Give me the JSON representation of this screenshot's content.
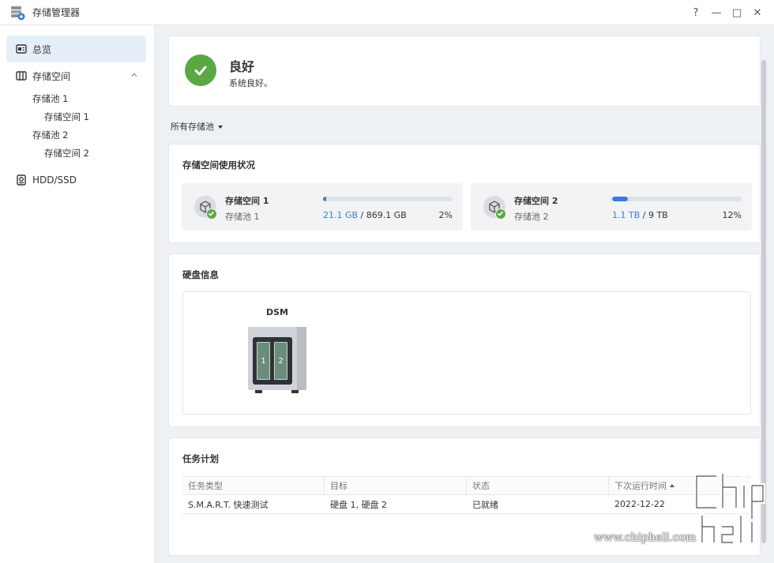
{
  "window": {
    "title": "存储管理器",
    "controls": [
      "?",
      "—",
      "□",
      "✕"
    ]
  },
  "sidebar": {
    "overview": "总览",
    "storage": "存储空间",
    "pool1": "存储池 1",
    "volume1": "存储空间 1",
    "pool2": "存储池 2",
    "volume2": "存储空间 2",
    "hdd": "HDD/SSD"
  },
  "status": {
    "title": "良好",
    "subtitle": "系统良好。",
    "color": "#5ba745"
  },
  "filter": {
    "label": "所有存储池"
  },
  "usage": {
    "title": "存储空间使用状况",
    "volumes": [
      {
        "name": "存储空间 1",
        "pool": "存储池 1",
        "used": "21.1 GB",
        "sep": " / ",
        "total": "869.1 GB",
        "percent": "2%",
        "fill": 0.024
      },
      {
        "name": "存储空间 2",
        "pool": "存储池 2",
        "used": "1.1 TB",
        "sep": " / ",
        "total": "9 TB",
        "percent": "12%",
        "fill": 0.12
      }
    ],
    "bar_color": "#3e7bd6"
  },
  "disk": {
    "title": "硬盘信息",
    "device": "DSM",
    "bays": [
      "1",
      "2"
    ]
  },
  "tasks": {
    "title": "任务计划",
    "columns": [
      "任务类型",
      "目标",
      "状态",
      "下次运行时间"
    ],
    "rows": [
      [
        "S.M.A.R.T. 快速测试",
        "硬盘 1, 硬盘 2",
        "已就绪",
        "2022-12-22"
      ]
    ]
  },
  "watermark": {
    "text": "www.chiphell.com"
  }
}
